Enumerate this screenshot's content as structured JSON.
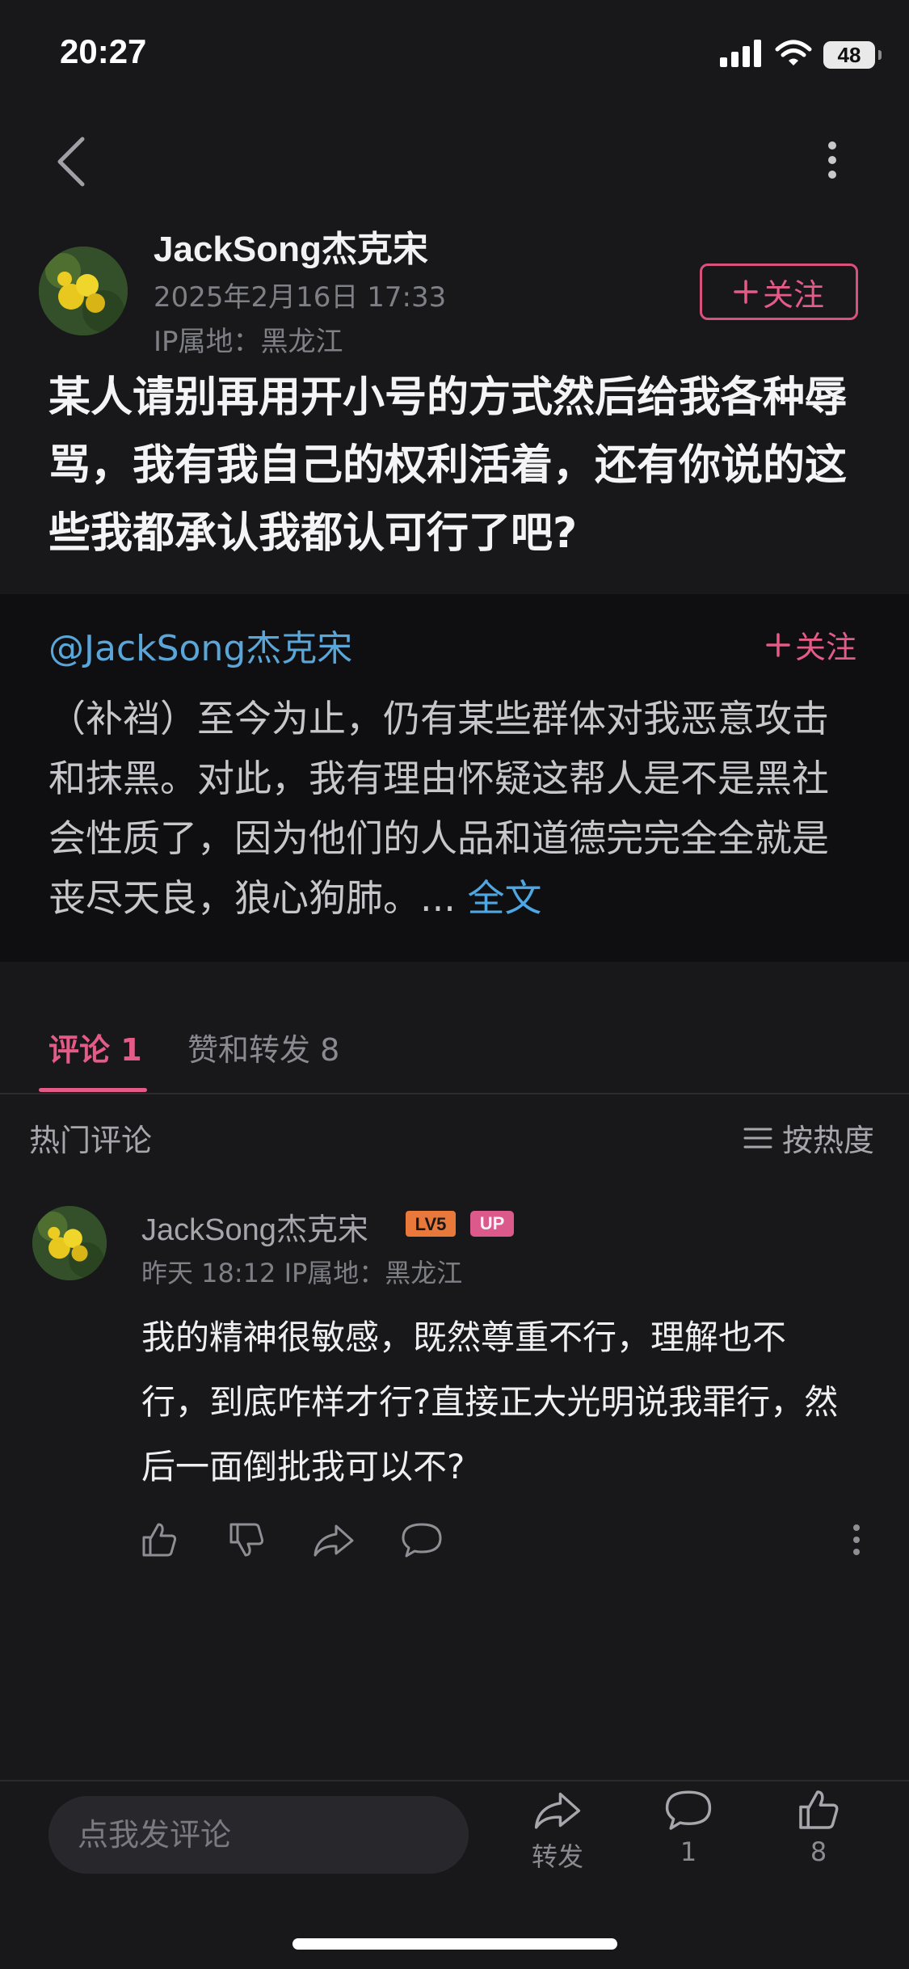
{
  "status_bar": {
    "time": "20:27",
    "battery": "48",
    "icons": [
      "signal-icon",
      "wifi-icon",
      "battery-icon"
    ]
  },
  "nav": {
    "icons": [
      "back-chevron-icon",
      "more-vertical-icon"
    ]
  },
  "post": {
    "author": "JackSong杰克宋",
    "date": "2025年2月16日 17:33",
    "ip_location": "IP属地：黑龙江",
    "follow_label": "关注",
    "text": "某人请别再用开小号的方式然后给我各种辱骂，我有我自己的权利活着，还有你说的这些我都承认我都认可行了吧?"
  },
  "quote": {
    "user": "@JackSong杰克宋",
    "follow_label": "关注",
    "text": "（补裆）至今为止，仍有某些群体对我恶意攻击和抹黑。对此，我有理由怀疑这帮人是不是黑社会性质了，因为他们的人品和道德完完全全就是丧尽天良，狼心狗肺。... ",
    "more_label": "全文"
  },
  "tabs": {
    "comments": "评论 1",
    "likes_reposts": "赞和转发 8"
  },
  "comments_section": {
    "hot_label": "热门评论",
    "sort_label": "按热度"
  },
  "comment": {
    "name": "JackSong杰克宋",
    "level_badge": "LV5",
    "up_badge": "UP",
    "meta": "昨天 18:12  IP属地：黑龙江",
    "text": "我的精神很敏感，既然尊重不行，理解也不行，到底咋样才行?直接正大光明说我罪行，然后一面倒批我可以不?"
  },
  "bottom_bar": {
    "input_placeholder": "点我发评论",
    "share_label": "转发",
    "comment_count": "1",
    "like_count": "8"
  },
  "colors": {
    "background": "#18181b",
    "accent_pink": "#e35b86",
    "link_blue": "#5aa6d8",
    "quote_bg": "#0f0f11"
  }
}
